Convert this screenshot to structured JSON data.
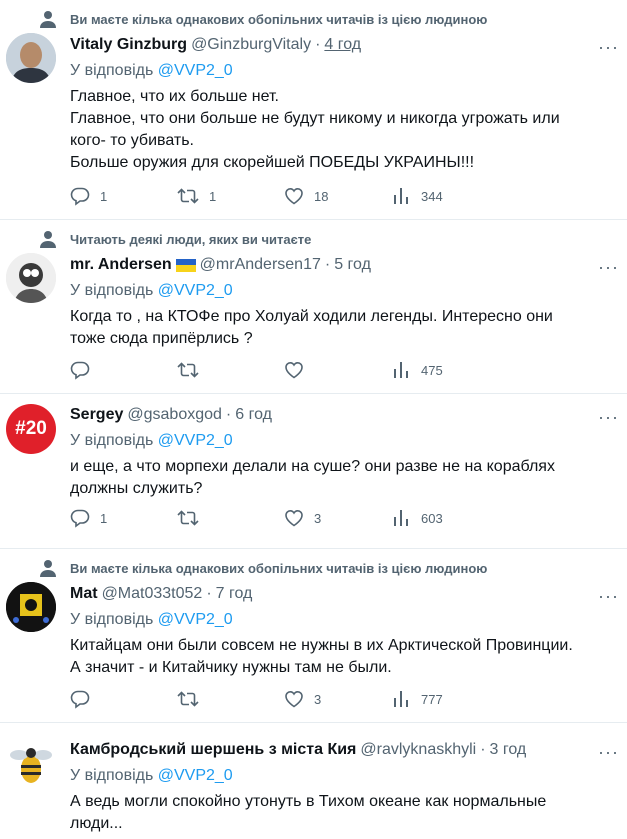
{
  "colors": {
    "accent": "#1d9bf0",
    "muted": "#536471",
    "text": "#0f1419",
    "divider": "#e6ecf0"
  },
  "tweets": [
    {
      "social_context": "Ви маєте кілька однакових обопільних читачів із цією людиною",
      "name": "Vitaly Ginzburg",
      "handle": "@GinzburgVitaly",
      "time": "4 год",
      "reply_prefix": "У відповідь",
      "reply_to": "@VVP2_0",
      "lines": [
        "Главное, что их больше нет.",
        "Главное, что они больше не будут никому и никогда угрожать или",
        "кого- то убивать.",
        "Больше оружия для скорейшей ПОБЕДЫ УКРАИНЫ!!!"
      ],
      "replies": "1",
      "retweets": "1",
      "likes": "18",
      "views": "344"
    },
    {
      "social_context": "Читають деякі люди, яких ви читаєте",
      "name": "mr. Andersen",
      "handle": "@mrAndersen17",
      "time": "5 год",
      "reply_prefix": "У відповідь",
      "reply_to": "@VVP2_0",
      "lines": [
        "Когда то , на КТОФе про Холуай ходили легенды. Интересно они",
        "тоже сюда припёрлись ?"
      ],
      "replies": "",
      "retweets": "",
      "likes": "",
      "views": "475"
    },
    {
      "name": "Sergey",
      "handle": "@gsaboxgod",
      "time": "6 год",
      "avatar_text": "#20",
      "reply_prefix": "У відповідь",
      "reply_to": "@VVP2_0",
      "lines": [
        "и еще, а что морпехи делали на суше? они разве не на кораблях",
        "должны служить?"
      ],
      "replies": "1",
      "retweets": "",
      "likes": "3",
      "views": "603"
    },
    {
      "social_context": "Ви маєте кілька однакових обопільних читачів із цією людиною",
      "name": "Mat",
      "handle": "@Mat033t052",
      "time": "7 год",
      "reply_prefix": "У відповідь",
      "reply_to": "@VVP2_0",
      "lines": [
        "Китайцам они были совсем не нужны в их Арктической Провинции.",
        "А значит - и Китайчику нужны там не были."
      ],
      "replies": "",
      "retweets": "",
      "likes": "3",
      "views": "777"
    },
    {
      "name": "Камбродський шершень з міста Кия",
      "handle": "@ravlyknaskhyli",
      "time": "3 год",
      "reply_prefix": "У відповідь",
      "reply_to": "@VVP2_0",
      "lines": [
        "А ведь могли спокойно утонуть в Тихом океане как нормальные",
        "люди..."
      ]
    }
  ]
}
